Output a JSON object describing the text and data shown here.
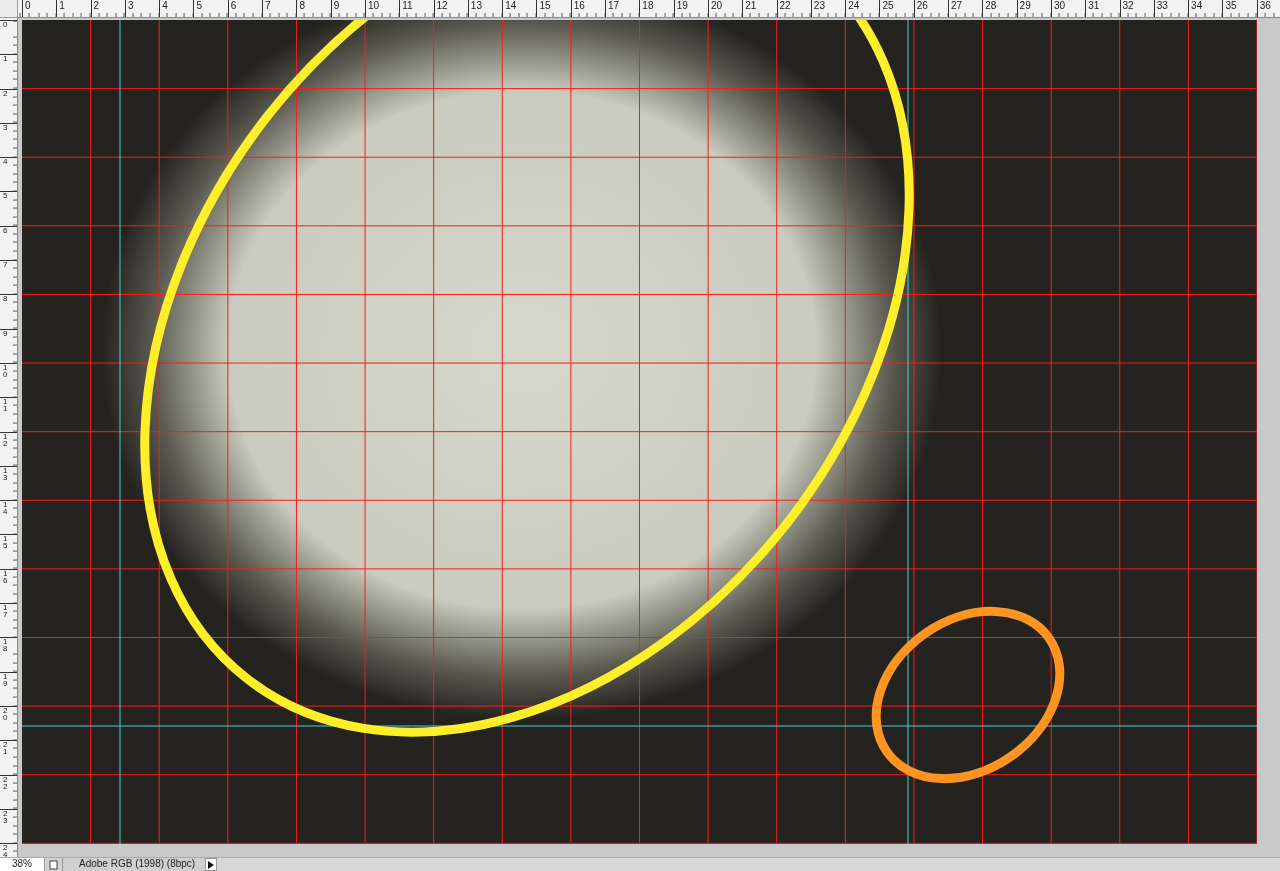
{
  "rulers": {
    "horizontal": [
      "0",
      "1",
      "2",
      "3",
      "4",
      "5",
      "6",
      "7",
      "8",
      "9",
      "10",
      "11",
      "12",
      "13",
      "14",
      "15",
      "16",
      "17",
      "18",
      "19",
      "20",
      "21",
      "22",
      "23",
      "24",
      "25",
      "26",
      "27",
      "28",
      "29",
      "30",
      "31",
      "32",
      "33",
      "34",
      "35",
      "36"
    ],
    "vertical": [
      "0",
      "1",
      "2",
      "3",
      "4",
      "5",
      "6",
      "7",
      "8",
      "9",
      "10",
      "11",
      "12",
      "13",
      "14",
      "15",
      "16",
      "17",
      "18",
      "19",
      "20",
      "21",
      "22",
      "23",
      "24"
    ]
  },
  "status_bar": {
    "zoom": "38%",
    "document_info": "Adobe RGB (1998) (8bpc)"
  }
}
